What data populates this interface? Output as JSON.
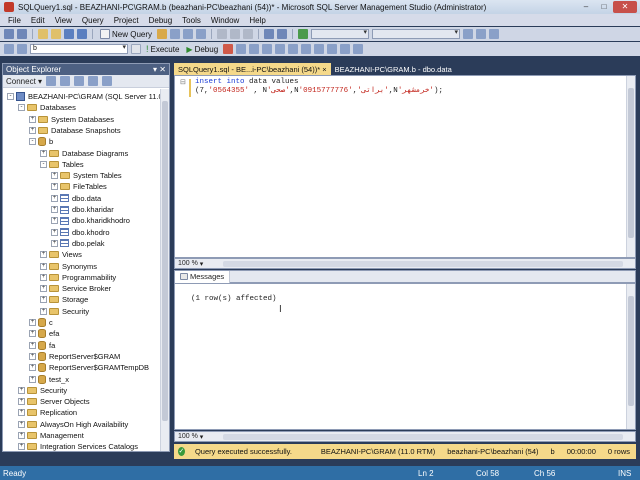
{
  "window": {
    "title": "SQLQuery1.sql - BEAZHANI-PC\\GRAM.b (beazhani-PC\\beazhani (54))* - Microsoft SQL Server Management Studio (Administrator)"
  },
  "menu": [
    "File",
    "Edit",
    "View",
    "Query",
    "Project",
    "Debug",
    "Tools",
    "Window",
    "Help"
  ],
  "toolbar1": {
    "new_query": "New Query"
  },
  "toolbar2": {
    "database": "b",
    "execute": "Execute",
    "debug": "Debug"
  },
  "object_explorer": {
    "title": "Object Explorer",
    "connect": "Connect ▾",
    "tree": [
      {
        "label": "BEAZHANI-PC\\GRAM (SQL Server 11.0",
        "icon": "server",
        "level": 0,
        "exp": "-"
      },
      {
        "label": "Databases",
        "icon": "folder",
        "level": 1,
        "exp": "-"
      },
      {
        "label": "System Databases",
        "icon": "folder",
        "level": 2,
        "exp": "+"
      },
      {
        "label": "Database Snapshots",
        "icon": "folder",
        "level": 2,
        "exp": "+"
      },
      {
        "label": "b",
        "icon": "db",
        "level": 2,
        "exp": "-"
      },
      {
        "label": "Database Diagrams",
        "icon": "folder",
        "level": 3,
        "exp": "+"
      },
      {
        "label": "Tables",
        "icon": "folder",
        "level": 3,
        "exp": "-"
      },
      {
        "label": "System Tables",
        "icon": "folder",
        "level": 4,
        "exp": "+"
      },
      {
        "label": "FileTables",
        "icon": "folder",
        "level": 4,
        "exp": "+"
      },
      {
        "label": "dbo.data",
        "icon": "table",
        "level": 4,
        "exp": "+"
      },
      {
        "label": "dbo.kharidar",
        "icon": "table",
        "level": 4,
        "exp": "+"
      },
      {
        "label": "dbo.kharidkhodro",
        "icon": "table",
        "level": 4,
        "exp": "+"
      },
      {
        "label": "dbo.khodro",
        "icon": "table",
        "level": 4,
        "exp": "+"
      },
      {
        "label": "dbo.pelak",
        "icon": "table",
        "level": 4,
        "exp": "+"
      },
      {
        "label": "Views",
        "icon": "folder",
        "level": 3,
        "exp": "+"
      },
      {
        "label": "Synonyms",
        "icon": "folder",
        "level": 3,
        "exp": "+"
      },
      {
        "label": "Programmability",
        "icon": "folder",
        "level": 3,
        "exp": "+"
      },
      {
        "label": "Service Broker",
        "icon": "folder",
        "level": 3,
        "exp": "+"
      },
      {
        "label": "Storage",
        "icon": "folder",
        "level": 3,
        "exp": "+"
      },
      {
        "label": "Security",
        "icon": "folder",
        "level": 3,
        "exp": "+"
      },
      {
        "label": "c",
        "icon": "db",
        "level": 2,
        "exp": "+"
      },
      {
        "label": "efa",
        "icon": "db",
        "level": 2,
        "exp": "+"
      },
      {
        "label": "fa",
        "icon": "db",
        "level": 2,
        "exp": "+"
      },
      {
        "label": "ReportServer$GRAM",
        "icon": "db",
        "level": 2,
        "exp": "+"
      },
      {
        "label": "ReportServer$GRAMTempDB",
        "icon": "db",
        "level": 2,
        "exp": "+"
      },
      {
        "label": "test_x",
        "icon": "db",
        "level": 2,
        "exp": "+"
      },
      {
        "label": "Security",
        "icon": "folder",
        "level": 1,
        "exp": "+"
      },
      {
        "label": "Server Objects",
        "icon": "folder",
        "level": 1,
        "exp": "+"
      },
      {
        "label": "Replication",
        "icon": "folder",
        "level": 1,
        "exp": "+"
      },
      {
        "label": "AlwaysOn High Availability",
        "icon": "folder",
        "level": 1,
        "exp": "+"
      },
      {
        "label": "Management",
        "icon": "folder",
        "level": 1,
        "exp": "+"
      },
      {
        "label": "Integration Services Catalogs",
        "icon": "folder",
        "level": 1,
        "exp": "+"
      }
    ]
  },
  "tabs": [
    {
      "label": "SQLQuery1.sql - BE...i-PC\\beazhani (54))*",
      "close": "×",
      "active": true
    },
    {
      "label": "BEAZHANI-PC\\GRAM.b - dbo.data",
      "close": "",
      "active": false
    }
  ],
  "editor": {
    "line1_kw": "insert into",
    "line1_rest": " data values",
    "line2_open": "(7,",
    "line2_str1": "'0564355'",
    "line2_mid1": " , N",
    "line2_str2": "'صحی'",
    "line2_mid2": ",N",
    "line2_str3": "'براتی'",
    "line2_mid3": ",",
    "line2_str4": "'0915777776'",
    "line2_mid4": ",N",
    "line2_str5": "'خرمشهر'",
    "line2_close": ");"
  },
  "zoom": {
    "editor": "100 %",
    "results": "100 %"
  },
  "results": {
    "tab": "Messages",
    "message": "(1 row(s) affected)"
  },
  "query_status": {
    "message": "Query executed successfully.",
    "server": "BEAZHANI-PC\\GRAM (11.0 RTM)",
    "user": "beazhani-PC\\beazhani (54)",
    "database": "b",
    "time": "00:00:00",
    "rows": "0 rows"
  },
  "statusbar": {
    "ready": "Ready",
    "ln": "Ln 2",
    "col": "Col 58",
    "ch": "Ch 56",
    "ins": "INS"
  }
}
